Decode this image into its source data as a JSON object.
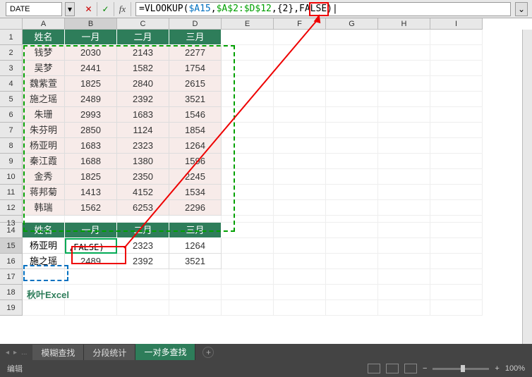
{
  "name_box": "DATE",
  "formula": {
    "full": "=VLOOKUP($A15,$A$2:$D$12,{2},FALSE)",
    "eq": "=",
    "fn": "VLOOKUP(",
    "ref1": "$A15",
    "comma1": ",",
    "ref2": "$A$2:$D$12",
    "comma2": ",",
    "num": "{2}",
    "comma3": ",",
    "tail": "FALSE)",
    "cursor": "|"
  },
  "cols": [
    "A",
    "B",
    "C",
    "D",
    "E",
    "F",
    "G",
    "H",
    "I"
  ],
  "rows": [
    "1",
    "2",
    "3",
    "4",
    "5",
    "6",
    "7",
    "8",
    "9",
    "10",
    "11",
    "12",
    "13",
    "14",
    "15",
    "16",
    "17",
    "18",
    "19"
  ],
  "table1": {
    "headers": [
      "姓名",
      "一月",
      "二月",
      "三月"
    ],
    "rows": [
      [
        "钱梦",
        "2030",
        "2143",
        "2277"
      ],
      [
        "吴梦",
        "2441",
        "1582",
        "1754"
      ],
      [
        "魏紫萱",
        "1825",
        "2840",
        "2615"
      ],
      [
        "施之瑶",
        "2489",
        "2392",
        "3521"
      ],
      [
        "朱珊",
        "2993",
        "1683",
        "1546"
      ],
      [
        "朱芬明",
        "2850",
        "1124",
        "1854"
      ],
      [
        "杨亚明",
        "1683",
        "2323",
        "1264"
      ],
      [
        "秦江霞",
        "1688",
        "1380",
        "1596"
      ],
      [
        "金秀",
        "1825",
        "2350",
        "2245"
      ],
      [
        "蒋邦菊",
        "1413",
        "4152",
        "1534"
      ],
      [
        "韩瑞",
        "1562",
        "6253",
        "2296"
      ]
    ]
  },
  "table2": {
    "headers": [
      "姓名",
      "一月",
      "二月",
      "三月"
    ],
    "rows": [
      [
        "杨亚明",
        ",FALSE)",
        "2323",
        "1264"
      ],
      [
        "施之瑶",
        "2489",
        "2392",
        "3521"
      ]
    ]
  },
  "watermark": "秋叶Excel",
  "tabs": {
    "items": [
      "模糊查找",
      "分段统计",
      "一对多查找"
    ],
    "active": 2,
    "ellipsis": "..."
  },
  "status": {
    "mode": "编辑",
    "zoom": "100%",
    "minus": "−",
    "plus": "+"
  },
  "icons": {
    "cancel": "✕",
    "confirm": "✓",
    "dropdown": "▾",
    "expand": "⌄",
    "nav_first": "◂",
    "nav_prev": "▸",
    "add": "+"
  }
}
